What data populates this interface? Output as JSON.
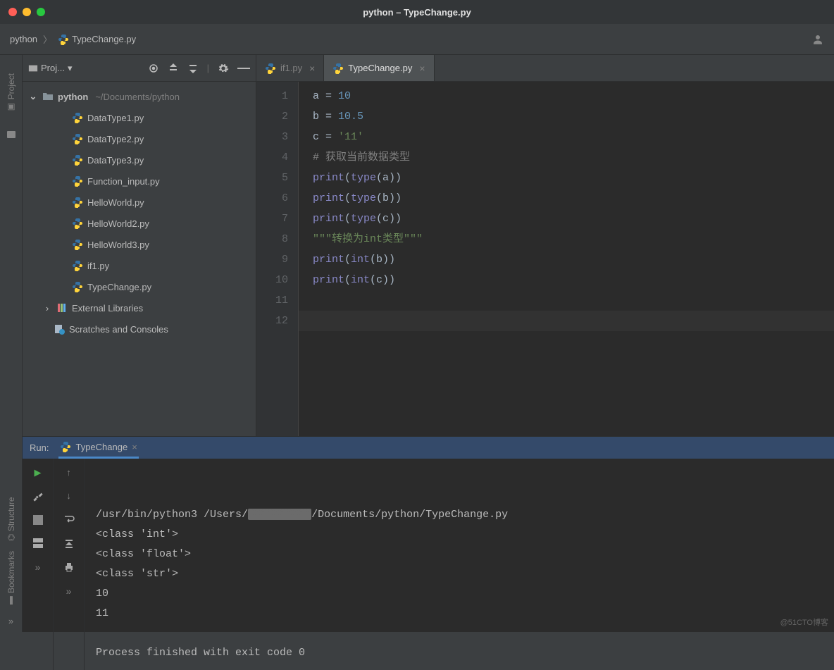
{
  "window": {
    "title": "python – TypeChange.py"
  },
  "breadcrumb": {
    "root": "python",
    "file": "TypeChange.py"
  },
  "sidebar_labels": {
    "project": "Project",
    "structure": "Structure",
    "bookmarks": "Bookmarks"
  },
  "project_panel": {
    "title": "Proj...",
    "root": {
      "name": "python",
      "path": "~/Documents/python"
    },
    "files": [
      "DataType1.py",
      "DataType2.py",
      "DataType3.py",
      "Function_input.py",
      "HelloWorld.py",
      "HelloWorld2.py",
      "HelloWorld3.py",
      "if1.py",
      "TypeChange.py"
    ],
    "external": "External Libraries",
    "scratches": "Scratches and Consoles"
  },
  "tabs": [
    {
      "label": "if1.py",
      "active": false
    },
    {
      "label": "TypeChange.py",
      "active": true
    }
  ],
  "editor": {
    "line_count": 12,
    "cursor_line": 12,
    "lines": [
      {
        "t": [
          {
            "c": "c-var",
            "v": "a"
          },
          {
            "c": "c-op",
            "v": " = "
          },
          {
            "c": "c-num",
            "v": "10"
          }
        ]
      },
      {
        "t": [
          {
            "c": "c-var",
            "v": "b"
          },
          {
            "c": "c-op",
            "v": " = "
          },
          {
            "c": "c-num",
            "v": "10.5"
          }
        ]
      },
      {
        "t": [
          {
            "c": "c-var",
            "v": "c"
          },
          {
            "c": "c-op",
            "v": " = "
          },
          {
            "c": "c-str",
            "v": "'11'"
          }
        ]
      },
      {
        "t": [
          {
            "c": "c-com",
            "v": "# 获取当前数据类型"
          }
        ]
      },
      {
        "t": [
          {
            "c": "c-call",
            "v": "print"
          },
          {
            "c": "c-op",
            "v": "("
          },
          {
            "c": "c-call",
            "v": "type"
          },
          {
            "c": "c-op",
            "v": "(a))"
          }
        ]
      },
      {
        "t": [
          {
            "c": "c-call",
            "v": "print"
          },
          {
            "c": "c-op",
            "v": "("
          },
          {
            "c": "c-call",
            "v": "type"
          },
          {
            "c": "c-op",
            "v": "(b))"
          }
        ]
      },
      {
        "t": [
          {
            "c": "c-call",
            "v": "print"
          },
          {
            "c": "c-op",
            "v": "("
          },
          {
            "c": "c-call",
            "v": "type"
          },
          {
            "c": "c-op",
            "v": "(c))"
          }
        ]
      },
      {
        "t": [
          {
            "c": "c-str",
            "v": "\"\"\"转换为int类型\"\"\""
          }
        ]
      },
      {
        "t": [
          {
            "c": "c-call",
            "v": "print"
          },
          {
            "c": "c-op",
            "v": "("
          },
          {
            "c": "c-call",
            "v": "int"
          },
          {
            "c": "c-op",
            "v": "(b))"
          }
        ]
      },
      {
        "t": [
          {
            "c": "c-call",
            "v": "print"
          },
          {
            "c": "c-op",
            "v": "("
          },
          {
            "c": "c-call",
            "v": "int"
          },
          {
            "c": "c-op",
            "v": "(c))"
          }
        ]
      },
      {
        "t": []
      },
      {
        "t": []
      }
    ]
  },
  "run": {
    "label": "Run:",
    "tab": "TypeChange",
    "cmd_prefix": "/usr/bin/python3 /Users/",
    "cmd_suffix": "/Documents/python/TypeChange.py",
    "output": [
      "<class 'int'>",
      "<class 'float'>",
      "<class 'str'>",
      "10",
      "11",
      "",
      "Process finished with exit code 0"
    ]
  },
  "watermark": "@51CTO博客"
}
